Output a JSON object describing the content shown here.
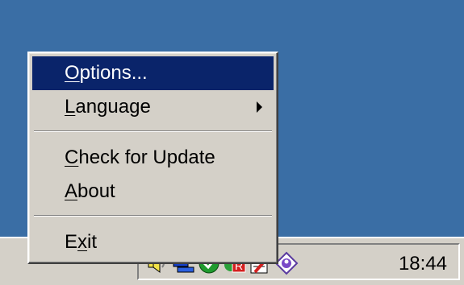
{
  "menu": {
    "items": [
      {
        "pre": "",
        "key": "O",
        "post": "ptions...",
        "state": "highlighted"
      },
      {
        "pre": "",
        "key": "L",
        "post": "anguage",
        "submenu": true
      },
      {
        "pre": "",
        "key": "C",
        "post": "heck for Update"
      },
      {
        "pre": "",
        "key": "A",
        "post": "bout"
      },
      {
        "pre": "E",
        "key": "x",
        "post": "it"
      }
    ]
  },
  "taskbar": {
    "clock": "18:44",
    "tray_icons": [
      "speaker-icon",
      "network-icon",
      "green-circle-app-icon",
      "antivirus-icon",
      "notepad-pencil-icon",
      "diamond-app-icon"
    ]
  },
  "colors": {
    "desktop": "#3a6ea5",
    "menu_bg": "#d4d0c8",
    "highlight": "#0a246a",
    "highlight_text": "#ffffff"
  }
}
